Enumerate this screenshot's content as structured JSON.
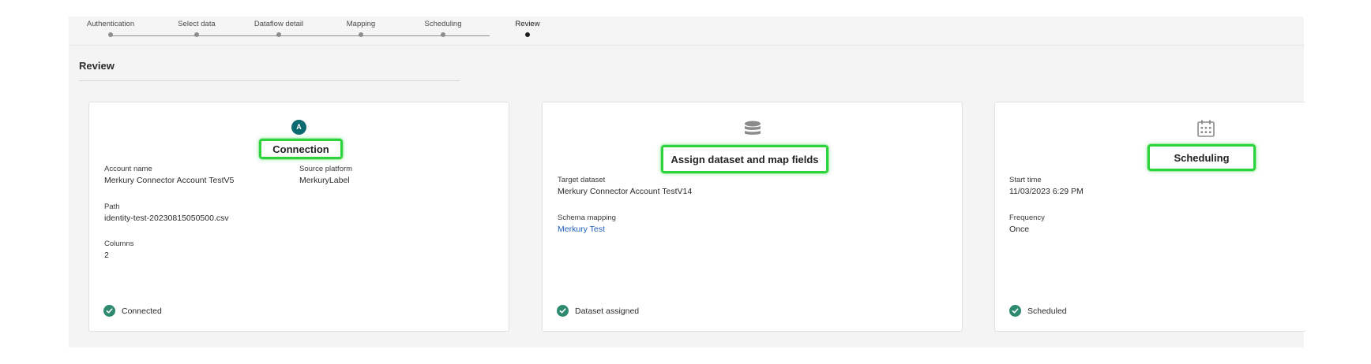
{
  "steps": [
    {
      "label": "Authentication",
      "state": "done"
    },
    {
      "label": "Select data",
      "state": "done"
    },
    {
      "label": "Dataflow detail",
      "state": "done"
    },
    {
      "label": "Mapping",
      "state": "done"
    },
    {
      "label": "Scheduling",
      "state": "done"
    },
    {
      "label": "Review",
      "state": "active"
    }
  ],
  "page": {
    "title": "Review"
  },
  "connection": {
    "avatar_letter": "A",
    "title": "Connection",
    "account_name_label": "Account name",
    "account_name_value": "Merkury Connector Account TestV5",
    "source_platform_label": "Source platform",
    "source_platform_value": "MerkuryLabel",
    "path_label": "Path",
    "path_value": "identity-test-20230815050500.csv",
    "columns_label": "Columns",
    "columns_value": "2",
    "status": "Connected"
  },
  "dataset": {
    "icon": "database-icon",
    "title": "Assign dataset and map fields",
    "target_label": "Target dataset",
    "target_value": "Merkury Connector Account TestV14",
    "schema_label": "Schema mapping",
    "schema_value": "Merkury Test",
    "status": "Dataset assigned"
  },
  "scheduling": {
    "icon": "calendar-icon",
    "title": "Scheduling",
    "start_label": "Start time",
    "start_value": "11/03/2023 6:29 PM",
    "frequency_label": "Frequency",
    "frequency_value": "Once",
    "status": "Scheduled"
  },
  "colors": {
    "highlight": "#2cd33a",
    "status_green": "#2d8a6f",
    "avatar": "#0b6a70",
    "link": "#1f5fbf"
  }
}
